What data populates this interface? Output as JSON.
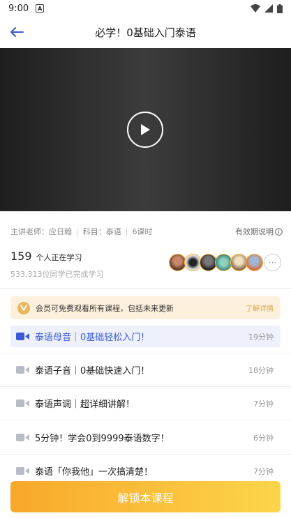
{
  "status_bar": {
    "time": "9:00",
    "notification_letter": "A"
  },
  "nav": {
    "title": "必学！0基础入门泰语"
  },
  "course_meta": {
    "teacher": "主讲老师：应日翰",
    "subject": "科目：泰语",
    "lessons_count": "6课时",
    "validity_label": "有效期说明"
  },
  "stats": {
    "learning_count": "159",
    "learning_label": "个人正在学习",
    "completed_text": "533,313位同学已完成学习"
  },
  "avatars": [
    "avatar-1",
    "avatar-2",
    "avatar-3",
    "avatar-4",
    "avatar-5",
    "avatar-6"
  ],
  "avatar_more": "···",
  "vip": {
    "text": "会员可免费观看所有课程，包括未来更新",
    "link": "了解详情"
  },
  "lessons": [
    {
      "title": "泰语母音｜0基础轻松入门！",
      "duration": "19分钟",
      "active": true
    },
    {
      "title": "泰语子音｜0基础快速入门！",
      "duration": "18分钟",
      "active": false
    },
    {
      "title": "泰语声调｜超详细讲解！",
      "duration": "7分钟",
      "active": false
    },
    {
      "title": "5分钟！学会0到9999泰语数字！",
      "duration": "6分钟",
      "active": false
    },
    {
      "title": "泰语「你我他」一次搞清楚！",
      "duration": "7分钟",
      "active": false
    }
  ],
  "unlock_button": "解锁本课程",
  "colors": {
    "accent": "#3a5ad8",
    "vip_gold": "#e8b65b",
    "cta_start": "#f9a82a",
    "cta_end": "#fcd54a"
  }
}
